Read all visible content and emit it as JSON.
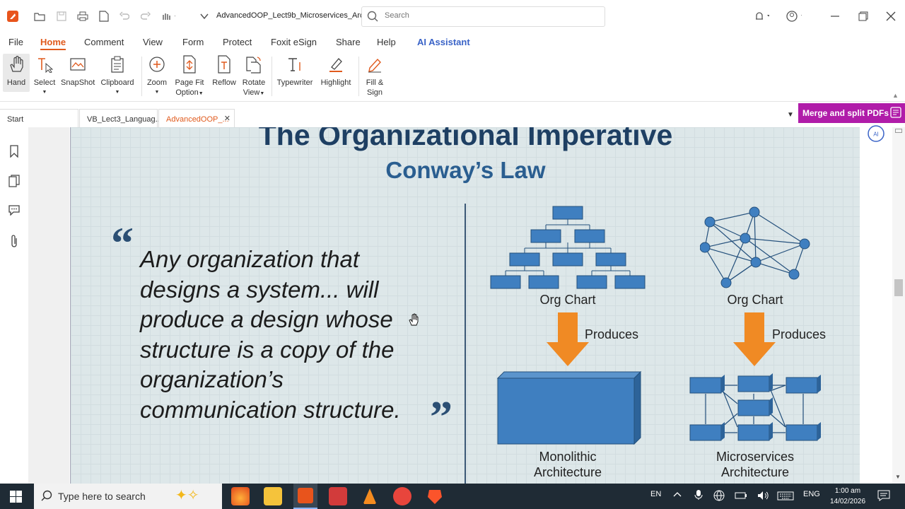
{
  "window": {
    "title": "AdvancedOOP_Lect9b_Microservices_Arc...",
    "search_placeholder": "Search"
  },
  "menu": [
    "File",
    "Home",
    "Comment",
    "View",
    "Form",
    "Protect",
    "Foxit eSign",
    "Share",
    "Help",
    "AI Assistant"
  ],
  "ribbon": {
    "hand": "Hand",
    "select": "Select",
    "snapshot": "SnapShot",
    "clipboard": "Clipboard",
    "zoom": "Zoom",
    "pagefit_1": "Page Fit",
    "pagefit_2": "Option",
    "reflow": "Reflow",
    "rotate_1": "Rotate",
    "rotate_2": "View",
    "typewriter": "Typewriter",
    "highlight": "Highlight",
    "fill_1": "Fill &",
    "fill_2": "Sign"
  },
  "tabs": {
    "start": "Start",
    "tab1": "VB_Lect3_Languag...",
    "tab2": "AdvancedOOP_..."
  },
  "banner": "Merge and split PDFs",
  "slide": {
    "title": "The Organizational Imperative",
    "subtitle": "Conway’s Law",
    "quote": "Any organization that designs a system... will produce a design whose structure is a copy of the organization’s communication structure.",
    "open_quote": "“",
    "close_quote": "”",
    "left_org": "Org Chart",
    "right_org": "Org Chart",
    "produces_left": "Produces",
    "produces_right": "Produces",
    "mono_1": "Monolithic",
    "mono_2": "Architecture",
    "micro_1": "Microservices",
    "micro_2": "Architecture"
  },
  "taskbar": {
    "search": "Type here to search",
    "lang": "EN",
    "eng": "ENG",
    "time": "1:00 am",
    "date": "14/02/2026"
  },
  "colors": {
    "accent": "#e05a1d",
    "banner": "#b01ca9",
    "box_blue": "#3f7fc0",
    "arrow_orange": "#f08a24",
    "title_navy": "#1e3f63"
  }
}
